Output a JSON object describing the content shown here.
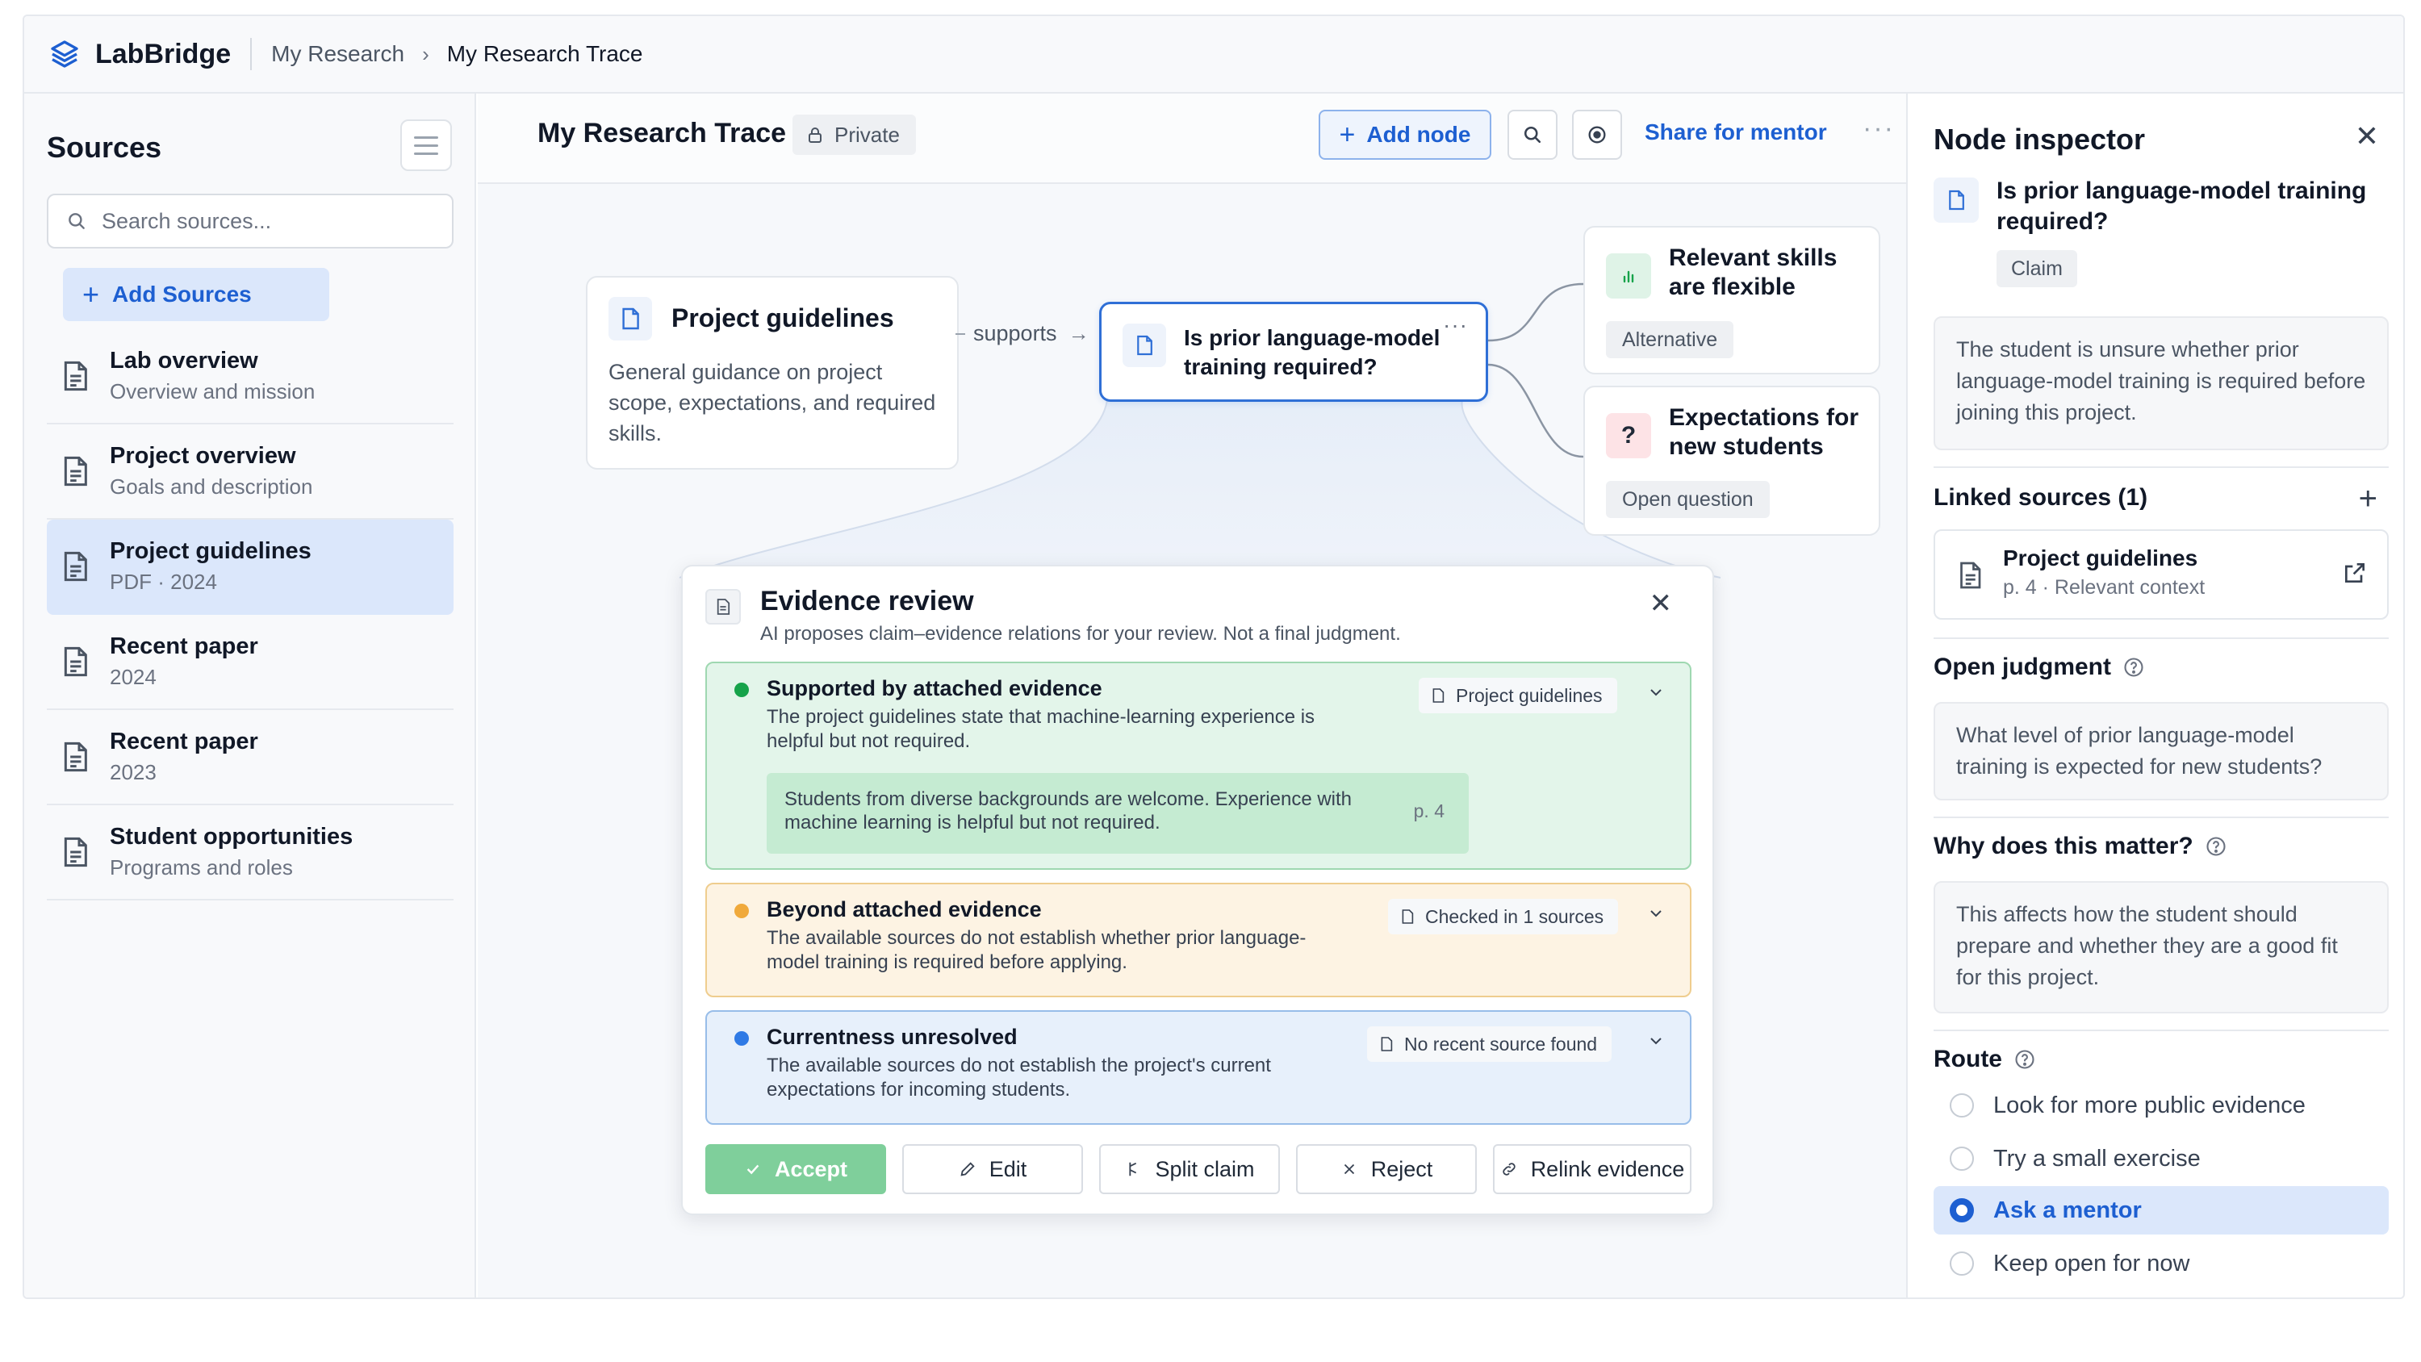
{
  "app": {
    "name": "LabBridge",
    "breadcrumb": [
      "My Research",
      "My Research Trace"
    ]
  },
  "sidebar": {
    "title": "Sources",
    "search_placeholder": "Search sources...",
    "add_label": "Add Sources",
    "items": [
      {
        "title": "Lab overview",
        "subtitle": "Overview and mission"
      },
      {
        "title": "Project overview",
        "subtitle": "Goals and description"
      },
      {
        "title": "Project guidelines",
        "subtitle": "PDF · 2024",
        "active": true
      },
      {
        "title": "Recent paper",
        "subtitle": "2024"
      },
      {
        "title": "Recent paper",
        "subtitle": "2023"
      },
      {
        "title": "Student opportunities",
        "subtitle": "Programs and roles"
      }
    ]
  },
  "canvas": {
    "title": "My Research Trace",
    "visibility": "Private",
    "add_node_label": "Add node",
    "share_label": "Share for mentor",
    "nodes": {
      "guidelines": {
        "title": "Project guidelines",
        "body": "General guidance on project scope, expectations, and required skills."
      },
      "edge_label": "supports",
      "claim": {
        "title": "Is prior language-model training required?"
      },
      "skills": {
        "title": "Relevant skills are flexible",
        "tag": "Alternative"
      },
      "expectations": {
        "title": "Expectations for new students",
        "tag": "Open question",
        "icon_glyph": "?"
      }
    }
  },
  "review": {
    "title": "Evidence review",
    "subtitle": "AI proposes claim–evidence relations for your review. Not a final judgment.",
    "items": [
      {
        "title": "Supported by attached evidence",
        "desc": "The project guidelines state that machine-learning experience is helpful but not required.",
        "tag": "Project guidelines",
        "quote": "Students from diverse backgrounds are welcome. Experience with machine learning is helpful but not required.",
        "quote_page": "p. 4",
        "color": "#16a34a"
      },
      {
        "title": "Beyond attached evidence",
        "desc": "The available sources do not establish whether prior language-model training is required before applying.",
        "tag": "Checked in 1 sources",
        "color": "#f0a93b"
      },
      {
        "title": "Currentness unresolved",
        "desc": "The available sources do not establish the project's current expectations for incoming students.",
        "tag": "No recent source found",
        "color": "#2f7ae5"
      }
    ],
    "actions": {
      "accept": "Accept",
      "edit": "Edit",
      "split": "Split claim",
      "reject": "Reject",
      "relink": "Relink evidence"
    }
  },
  "inspector": {
    "title": "Node inspector",
    "claim_title": "Is prior language-model training required?",
    "claim_type": "Claim",
    "claim_desc": "The student is unsure whether prior language-model training is required before joining this project.",
    "linked_heading": "Linked sources (1)",
    "linked": {
      "title": "Project guidelines",
      "meta": "p. 4 · Relevant context"
    },
    "open_judgment_heading": "Open judgment",
    "open_judgment_text": "What level of prior language-model training is expected for new students?",
    "why_heading": "Why does this matter?",
    "why_text": "This affects how the student should prepare and whether they are a good fit for this project.",
    "route_heading": "Route",
    "route_options": [
      {
        "label": "Look for more public evidence",
        "selected": false
      },
      {
        "label": "Try a small exercise",
        "selected": false
      },
      {
        "label": "Ask a mentor",
        "selected": true
      },
      {
        "label": "Keep open for now",
        "selected": false
      }
    ]
  }
}
